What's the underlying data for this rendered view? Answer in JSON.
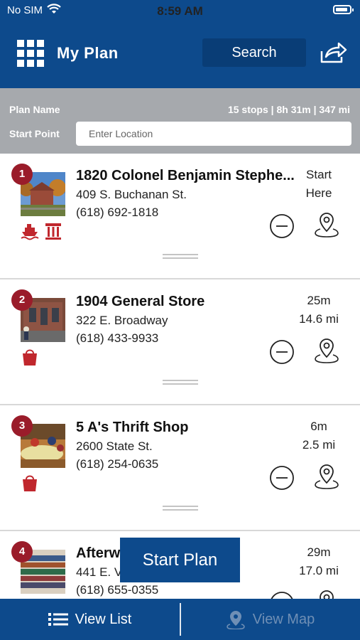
{
  "status": {
    "carrier": "No SIM",
    "time": "8:59 AM"
  },
  "header": {
    "title": "My Plan",
    "search_label": "Search"
  },
  "plan": {
    "name_label": "Plan Name",
    "summary": "15 stops | 8h 31m | 347 mi",
    "start_label": "Start Point",
    "start_placeholder": "Enter Location"
  },
  "stops": [
    {
      "num": "1",
      "name": "1820 Colonel Benjamin Stephe...",
      "address": "409 S. Buchanan St.",
      "phone": "(618) 692-1818",
      "time": "Start",
      "distance": "Here",
      "categories": [
        "ship-icon",
        "column-icon"
      ]
    },
    {
      "num": "2",
      "name": "1904 General Store",
      "address": "322 E. Broadway",
      "phone": "(618) 433-9933",
      "time": "25m",
      "distance": "14.6 mi",
      "categories": [
        "shopping-bag-icon"
      ]
    },
    {
      "num": "3",
      "name": "5 A's Thrift Shop",
      "address": "2600 State St.",
      "phone": "(618) 254-0635",
      "time": "6m",
      "distance": "2.5 mi",
      "categories": [
        "shopping-bag-icon"
      ]
    },
    {
      "num": "4",
      "name": "Afterw",
      "address": "441 E. V",
      "phone": "(618) 655-0355",
      "time": "29m",
      "distance": "17.0 mi",
      "categories": []
    }
  ],
  "start_plan_label": "Start Plan",
  "tabs": {
    "list_label": "View List",
    "map_label": "View Map"
  },
  "colors": {
    "brand_blue": "#0d4a8c",
    "accent_red": "#9a1c2a",
    "plan_bar_gray": "#a6a9ad"
  }
}
